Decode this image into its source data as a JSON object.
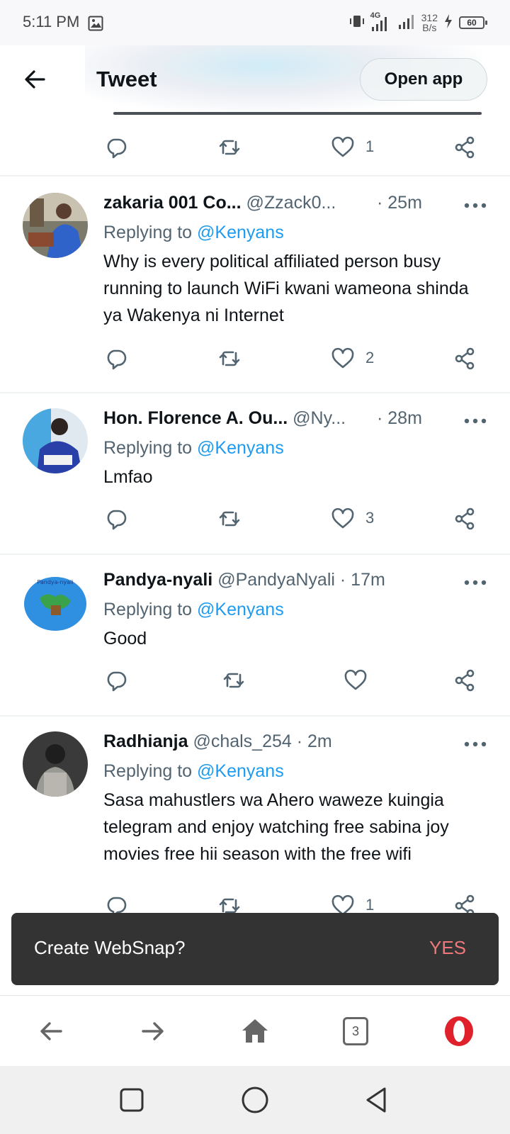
{
  "status_bar": {
    "time": "5:11 PM",
    "network_type": "4G",
    "speed_value": "312",
    "speed_unit": "B/s",
    "battery": "60"
  },
  "header": {
    "title": "Tweet",
    "open_app_label": "Open app"
  },
  "top_action_row": {
    "like_count": "1"
  },
  "tweets": [
    {
      "name": "zakaria 001 Co...",
      "handle": "@Zzack0...",
      "time": "· 25m",
      "replying_prefix": "Replying to ",
      "replying_to": "@Kenyans",
      "text": "Why is every political affiliated person busy running to launch WiFi kwani wameona shinda ya Wakenya ni Internet",
      "like_count": "2"
    },
    {
      "name": "Hon. Florence A. Ou...",
      "handle": "@Ny...",
      "time": "· 28m",
      "replying_prefix": "Replying to ",
      "replying_to": "@Kenyans",
      "text": "Lmfao",
      "like_count": "3"
    },
    {
      "name": "Pandya-nyali",
      "handle": "@PandyaNyali",
      "time": "· 17m",
      "replying_prefix": "Replying to ",
      "replying_to": "@Kenyans",
      "text": "Good",
      "like_count": ""
    },
    {
      "name": "Radhianja",
      "handle": "@chals_254",
      "time": "· 2m",
      "replying_prefix": "Replying to ",
      "replying_to": "@Kenyans",
      "text": "Sasa mahustlers wa Ahero waweze kuingia telegram and enjoy watching free sabina joy movies free hii season with the free wifi",
      "like_count": "1"
    }
  ],
  "snackbar": {
    "message": "Create WebSnap?",
    "action": "YES"
  },
  "browser_bar": {
    "tabs_count": "3"
  },
  "colors": {
    "accent": "#1d9bf0",
    "secondary_text": "#536471",
    "snackbar_action": "#f0787a",
    "opera_red": "#e0202a"
  }
}
